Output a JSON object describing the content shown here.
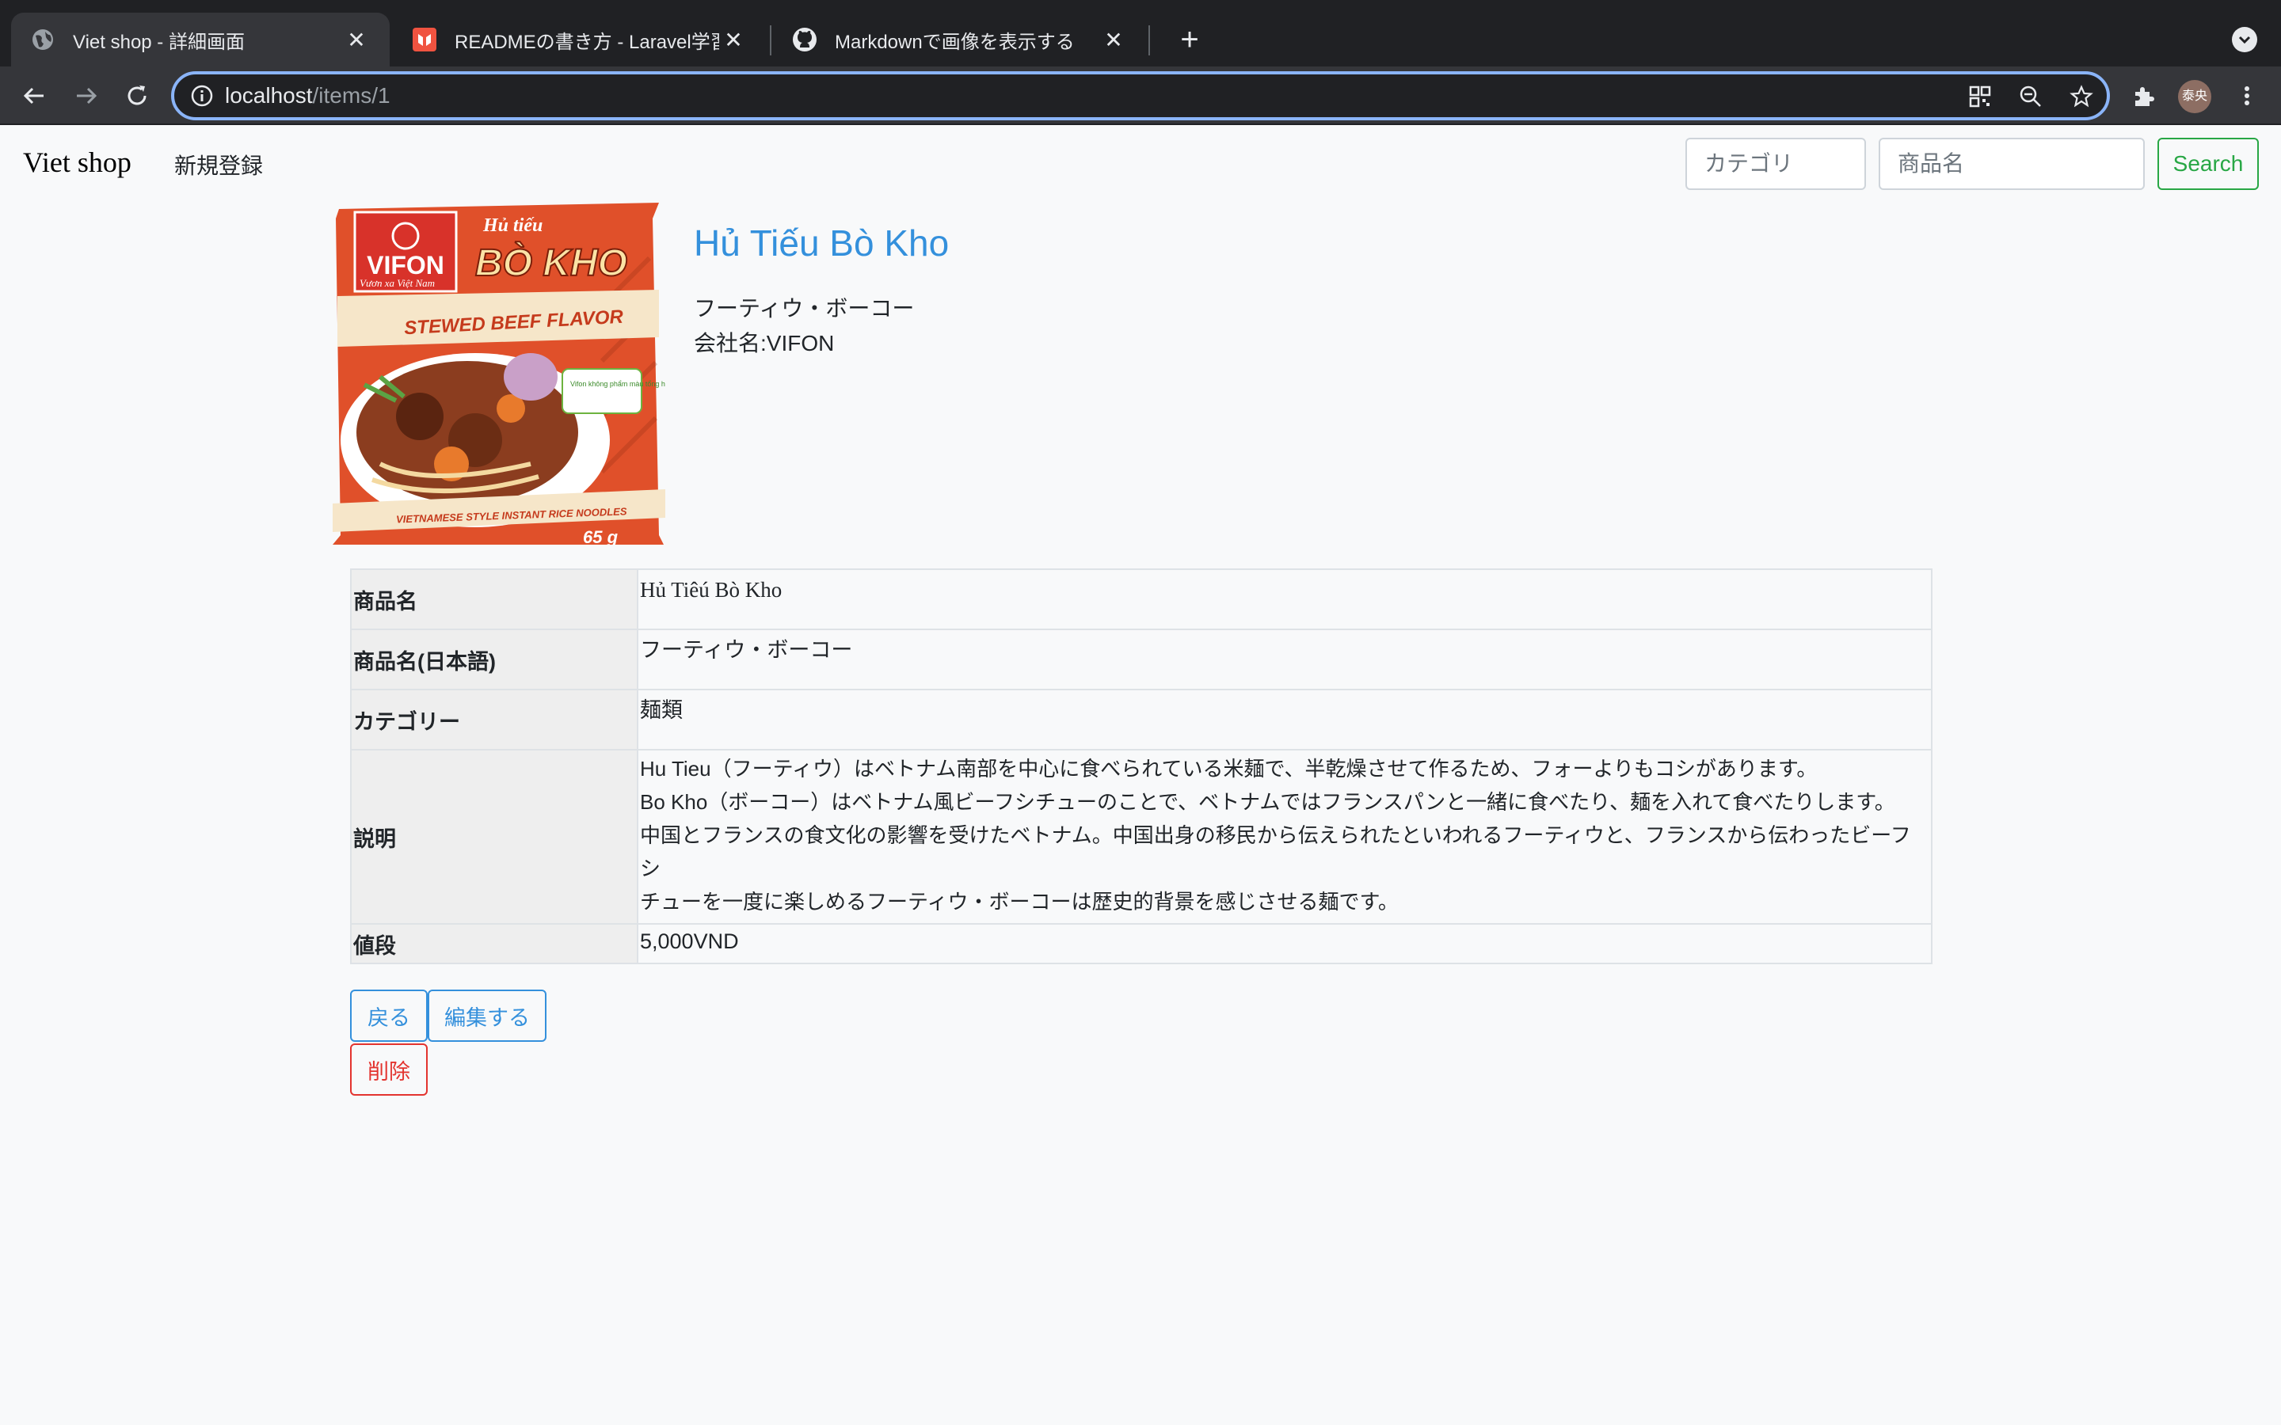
{
  "browser": {
    "tabs": [
      {
        "title": "Viet shop - 詳細画面",
        "favicon": "globe-icon"
      },
      {
        "title": "READMEの書き方 - Laravel学習帳",
        "favicon": "laravel-icon"
      },
      {
        "title": "Markdownで画像を表示する",
        "favicon": "github-icon"
      }
    ],
    "url_host": "localhost",
    "url_path": "/items/1",
    "profile_initials": "泰央"
  },
  "navbar": {
    "brand": "Viet shop",
    "register_link": "新規登録",
    "category_placeholder": "カテゴリ",
    "name_placeholder": "商品名",
    "search_label": "Search"
  },
  "product": {
    "image": {
      "brand": "VIFON",
      "brand_tagline": "Vươn xa Việt Nam",
      "title_small": "Hủ tiếu",
      "title_big": "BÒ KHO",
      "flavor": "STEWED BEEF FLAVOR",
      "badge": "Vifon không phẩm màu tổng hợp",
      "bottom": "VIETNAMESE STYLE INSTANT RICE NOODLES",
      "weight": "65 g"
    },
    "title": "Hủ Tiếu Bò Kho",
    "name_ja": "フーティウ・ボーコー",
    "company": "会社名:VIFON"
  },
  "details": {
    "rows": [
      {
        "label": "商品名",
        "value": "Hủ Tiêú Bò Kho"
      },
      {
        "label": "商品名(日本語)",
        "value": "フーティウ・ボーコー"
      },
      {
        "label": "カテゴリー",
        "value": "麺類"
      }
    ],
    "description_label": "説明",
    "description_lines": [
      "Hu Tieu（フーティウ）はベトナム南部を中心に食べられている米麺で、半乾燥させて作るため、フォーよりもコシがあります。",
      "Bo Kho（ボーコー）はベトナム風ビーフシチューのことで、ベトナムではフランスパンと一緒に食べたり、麺を入れて食べたりします。",
      "中国とフランスの食文化の影響を受けたベトナム。中国出身の移民から伝えられたといわれるフーティウと、フランスから伝わったビーフシ",
      "チューを一度に楽しめるフーティウ・ボーコーは歴史的背景を感じさせる麺です。"
    ],
    "price_label": "値段",
    "price": "5,000VND"
  },
  "actions": {
    "back": "戻る",
    "edit": "編集する",
    "delete": "削除"
  },
  "colors": {
    "accent": "#3490dc",
    "success": "#28a745",
    "danger": "#e3342f",
    "package": "#e0502a"
  }
}
